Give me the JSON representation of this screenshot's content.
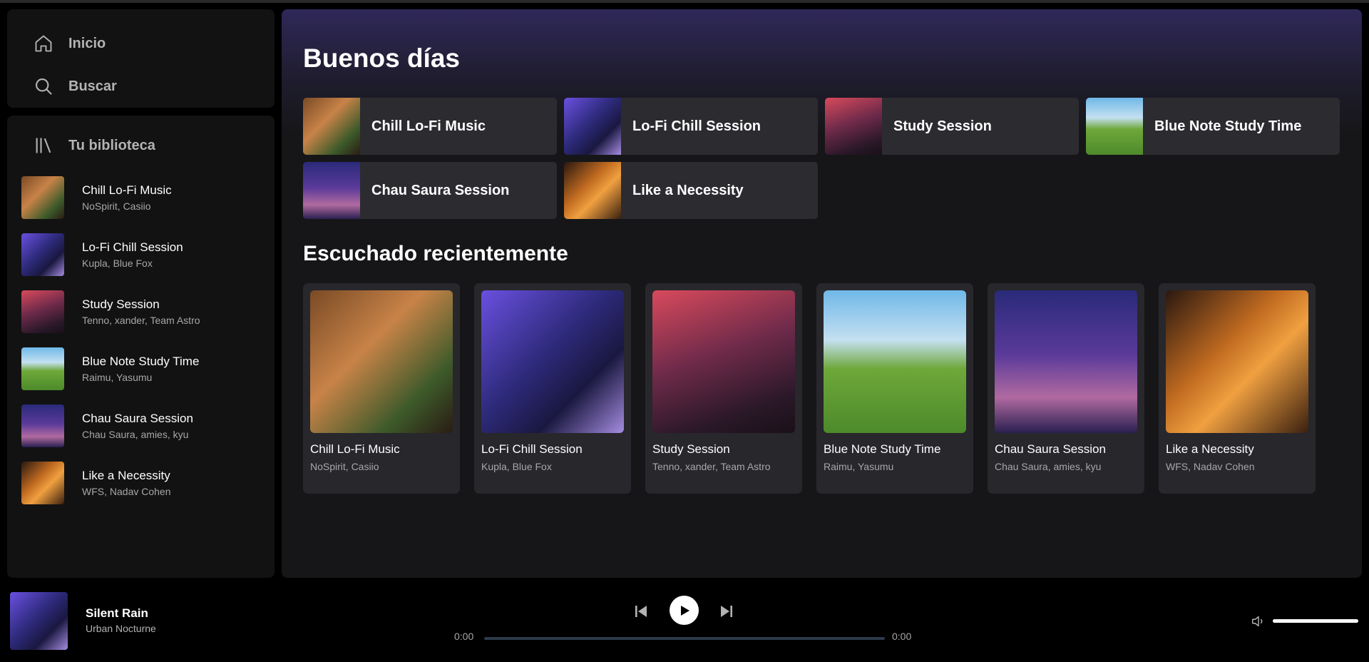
{
  "nav": {
    "home_label": "Inicio",
    "search_label": "Buscar"
  },
  "library": {
    "title": "Tu biblioteca",
    "items": [
      {
        "title": "Chill Lo-Fi Music",
        "artists": "NoSpirit, Casiio"
      },
      {
        "title": "Lo-Fi Chill Session",
        "artists": "Kupla, Blue Fox"
      },
      {
        "title": "Study Session",
        "artists": "Tenno, xander, Team Astro"
      },
      {
        "title": "Blue Note Study Time",
        "artists": "Raimu, Yasumu"
      },
      {
        "title": "Chau Saura Session",
        "artists": "Chau Saura, amies, kyu"
      },
      {
        "title": "Like a Necessity",
        "artists": "WFS, Nadav Cohen"
      }
    ]
  },
  "main": {
    "greeting": "Buenos días",
    "quick": [
      {
        "label": "Chill Lo-Fi Music"
      },
      {
        "label": "Lo-Fi Chill Session"
      },
      {
        "label": "Study Session"
      },
      {
        "label": "Blue Note Study Time"
      },
      {
        "label": "Chau Saura Session"
      },
      {
        "label": "Like a Necessity"
      }
    ],
    "recent_title": "Escuchado recientemente",
    "recent": [
      {
        "title": "Chill Lo-Fi Music",
        "artists": "NoSpirit, Casiio"
      },
      {
        "title": "Lo-Fi Chill Session",
        "artists": "Kupla, Blue Fox"
      },
      {
        "title": "Study Session",
        "artists": "Tenno, xander, Team Astro"
      },
      {
        "title": "Blue Note Study Time",
        "artists": "Raimu, Yasumu"
      },
      {
        "title": "Chau Saura Session",
        "artists": "Chau Saura, amies, kyu"
      },
      {
        "title": "Like a Necessity",
        "artists": "WFS, Nadav Cohen"
      }
    ]
  },
  "player": {
    "title": "Silent Rain",
    "artist": "Urban Nocturne",
    "time_current": "0:00",
    "time_total": "0:00",
    "progress": 0,
    "volume": 1.0
  },
  "icons": {
    "home": "home-icon",
    "search": "search-icon",
    "library": "library-icon",
    "prev": "skip-previous-icon",
    "play": "play-icon",
    "next": "skip-next-icon",
    "volume": "volume-icon"
  },
  "colors": {
    "accent_purple": "#2f2859",
    "surface": "#121212",
    "card": "#28272c"
  }
}
